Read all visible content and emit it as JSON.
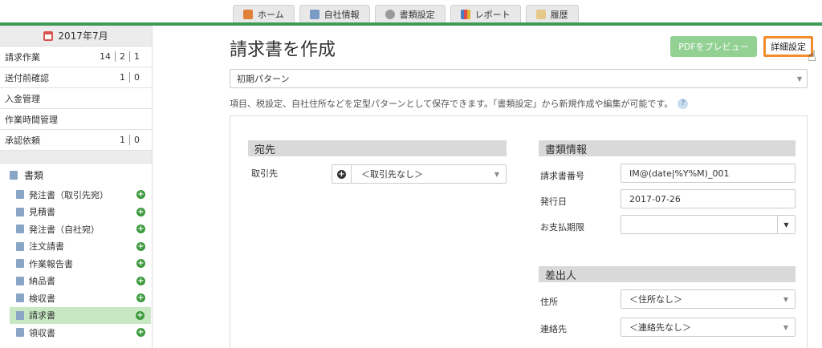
{
  "nav": {
    "tabs": [
      {
        "label": "ホーム",
        "icon": "home-icon"
      },
      {
        "label": "自社情報",
        "icon": "building-icon"
      },
      {
        "label": "書類設定",
        "icon": "gear-icon"
      },
      {
        "label": "レポート",
        "icon": "chart-icon"
      },
      {
        "label": "履歴",
        "icon": "history-icon"
      }
    ]
  },
  "sidebar": {
    "month": "2017年7月",
    "rows": [
      {
        "label": "請求作業",
        "nums": [
          "14",
          "2",
          "1"
        ]
      },
      {
        "label": "送付前確認",
        "nums": [
          "1",
          "0"
        ]
      },
      {
        "label": "入金管理",
        "nums": []
      },
      {
        "label": "作業時間管理",
        "nums": []
      },
      {
        "label": "承認依頼",
        "nums": [
          "1",
          "0"
        ]
      }
    ],
    "docs_title": "書類",
    "docs": [
      "発注書（取引先宛）",
      "見積書",
      "発注書（自社宛）",
      "注文請書",
      "作業報告書",
      "納品書",
      "検収書",
      "請求書",
      "領収書"
    ]
  },
  "main": {
    "title": "請求書を作成",
    "preview_button": "PDFをプレビュー",
    "detail_button": "詳細設定",
    "pattern_value": "初期パターン",
    "hint": "項目、税設定、自社住所などを定型パターンとして保存できます。「書類設定」から新規作成や編集が可能です。",
    "help": "?"
  },
  "form": {
    "to_title": "宛先",
    "client_label": "取引先",
    "client_value": "＜取引先なし＞",
    "info_title": "書類情報",
    "number_label": "請求書番号",
    "number_value": "IM@(date|%Y%M)_001",
    "issue_label": "発行日",
    "issue_value": "2017-07-26",
    "due_label": "お支払期限",
    "due_value": "",
    "sender_title": "差出人",
    "address_label": "住所",
    "address_value": "＜住所なし＞",
    "contact_label": "連絡先",
    "contact_value": "＜連絡先なし＞"
  },
  "colors": {
    "accent_green": "#3f9a55",
    "preview_button": "#93d193",
    "highlight_orange": "#f28b2c",
    "active_item": "#c8e8c4"
  }
}
